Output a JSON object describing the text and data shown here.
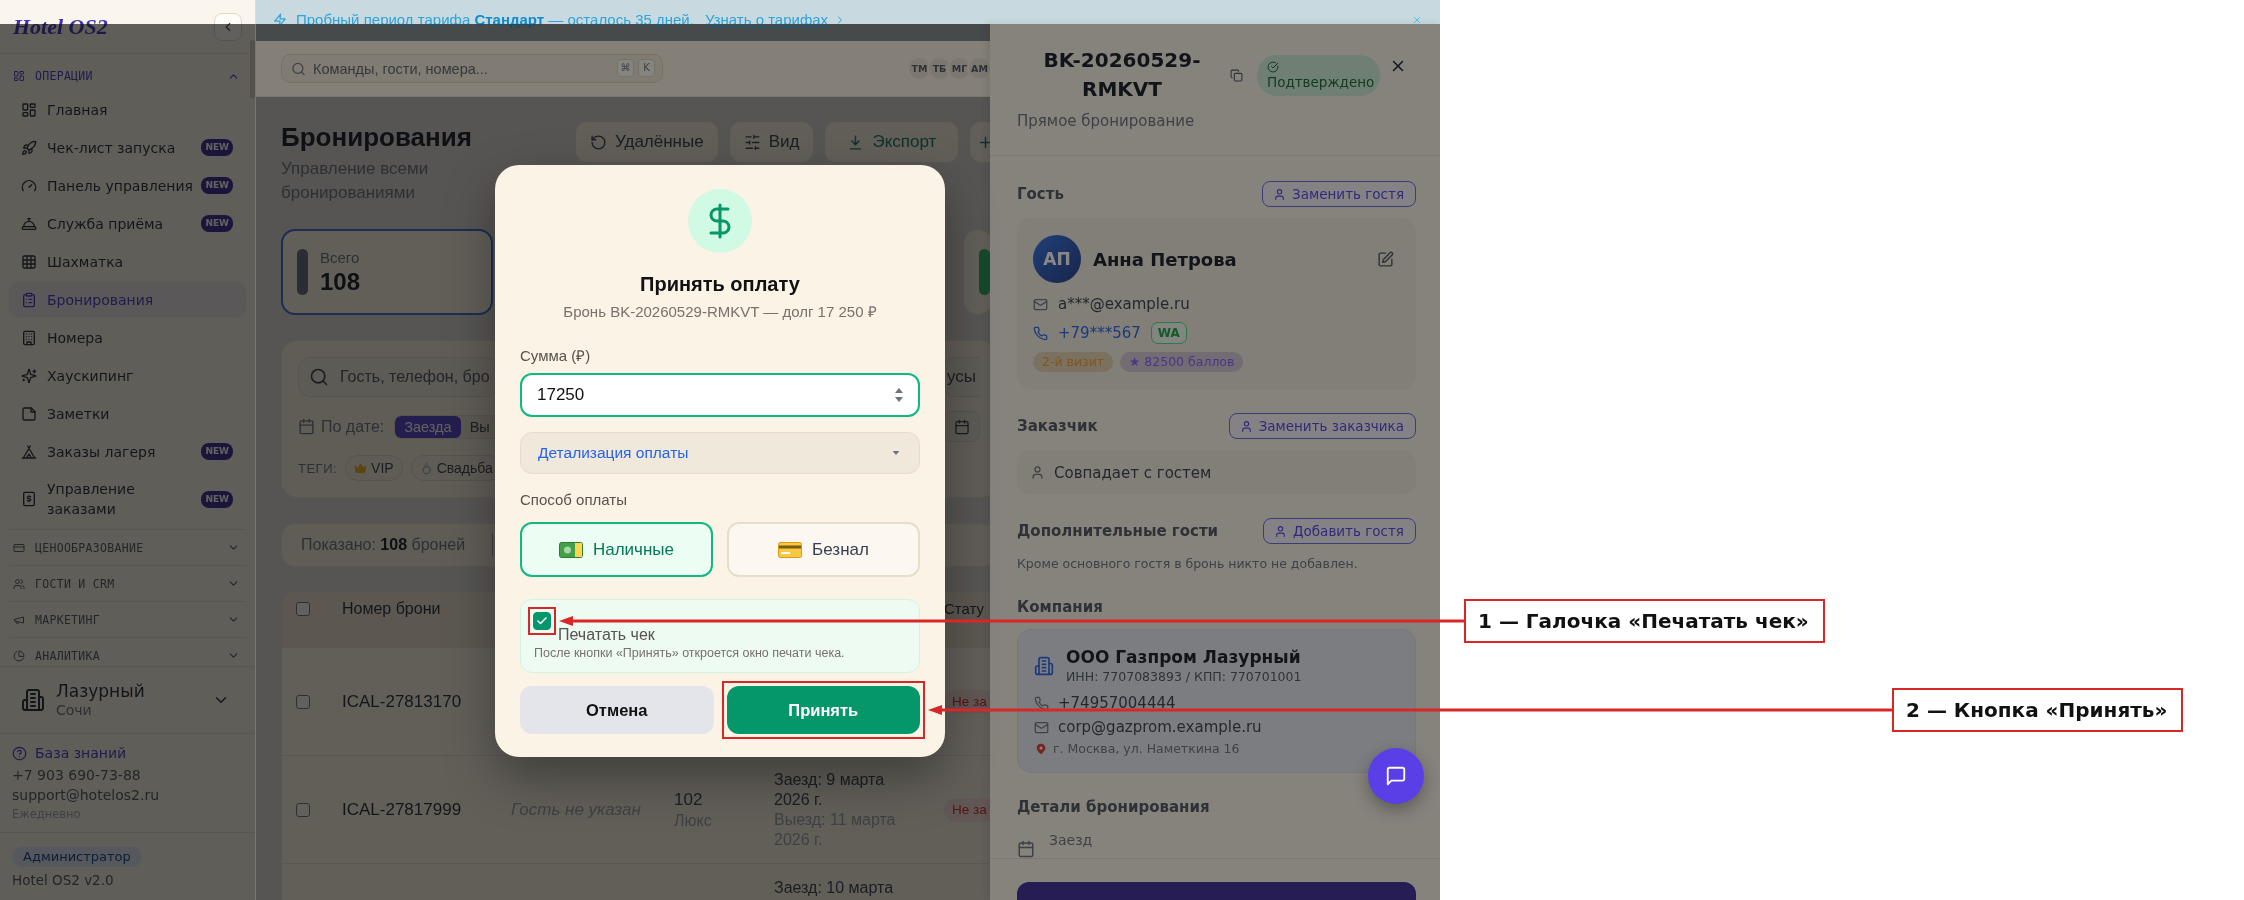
{
  "banner": {
    "message": "Пробный период тарифа **Стандарт** — осталось 35 дней.",
    "link": "Узнать о тарифах"
  },
  "sidebar": {
    "logo": "Hotel OS2",
    "sections": [
      {
        "title": "ОПЕРАЦИИ",
        "expanded": true,
        "items": [
          {
            "label": "Главная",
            "selected": false
          },
          {
            "label": "Чек-лист запуска",
            "badge": "NEW",
            "selected": false
          },
          {
            "label": "Панель управления",
            "badge": "NEW",
            "selected": false
          },
          {
            "label": "Служба приёма",
            "badge": "NEW",
            "selected": false
          },
          {
            "label": "Шахматка",
            "selected": false
          },
          {
            "label": "Бронирования",
            "selected": true
          },
          {
            "label": "Номера",
            "selected": false
          },
          {
            "label": "Хаускипинг",
            "selected": false
          },
          {
            "label": "Заметки",
            "selected": false
          },
          {
            "label": "Заказы лагеря",
            "badge": "NEW",
            "selected": false
          },
          {
            "label": "Управление заказами",
            "badge": "NEW",
            "selected": false
          }
        ]
      },
      {
        "title": "ЦЕНООБРАЗОВАНИЕ",
        "expanded": false
      },
      {
        "title": "ГОСТИ И CRM",
        "expanded": false
      },
      {
        "title": "МАРКЕТИНГ",
        "expanded": false
      },
      {
        "title": "АНАЛИТИКА",
        "expanded": false
      }
    ],
    "hotel": {
      "name": "Лазурный",
      "city": "Сочи"
    },
    "support": {
      "link": "База знаний",
      "phone": "+7 903 690-73-88",
      "email": "support@hotelos2.ru",
      "hours": "Ежедневно"
    },
    "role": "Администратор",
    "version": "Hotel OS2 v2.0"
  },
  "header": {
    "search": {
      "placeholder": "Команды, гости, номера...",
      "keys": [
        "⌘",
        "K"
      ]
    },
    "users": [
      "ТМ",
      "ТБ",
      "МГ",
      "АМ"
    ]
  },
  "page": {
    "title": "Бронирования",
    "subtitle": "Управление всеми бронированиями",
    "actions": [
      {
        "label": "Удалённые",
        "kind": "plain"
      },
      {
        "label": "Вид",
        "kind": "plain"
      },
      {
        "label": "Экспорт",
        "kind": "accent"
      },
      {
        "kind": "add"
      }
    ],
    "stats": [
      {
        "label": "Всего",
        "value": "108",
        "color": "#2a2d33",
        "selected": true
      },
      {
        "color": "#15482a",
        "selected": false
      }
    ],
    "filters": {
      "search": {
        "placeholder": "Гость, телефон, бро"
      },
      "status_filter": "усы",
      "date_label": "По дате:",
      "date_modes": [
        {
          "label": "Заезда",
          "selected": true
        },
        {
          "label": "Вы",
          "selected": false
        }
      ],
      "tags_label": "ТЕГИ:",
      "tags": [
        "VIP",
        "Свадьба"
      ]
    },
    "summary": "Показано: **108** броней",
    "table": {
      "header": {
        "checked": false,
        "booking_number": "Номер брони",
        "column_6": "Стату"
      },
      "rows": [
        {
          "checked": false,
          "booking_number": "ICAL-27813170",
          "status": "Не за"
        },
        {
          "checked": false,
          "booking_number": "ICAL-27817999",
          "guest": "Гость не указан",
          "room": "102",
          "room_type": "Люкс",
          "check_in": "Заезд: 9 марта 2026 г.",
          "check_out": "Выезд: 11 марта 2026 г.",
          "status": "Не за"
        },
        {
          "check_in": "Заезд: 10 марта"
        }
      ]
    }
  },
  "booking_panel": {
    "code": "BK-20260529-RMKVT",
    "status": "Подтверждено",
    "source": "Прямое бронирование",
    "guest": {
      "heading": "Гость",
      "action": "Заменить гостя",
      "initials": "АП",
      "name": "Анна Петрова",
      "email": "a***@example.ru",
      "phone": "+79***567",
      "messenger": "WA",
      "tags": [
        {
          "label": "2-й визит",
          "color": "#80551f"
        },
        {
          "label": "★ 82500 баллов",
          "color": "#4c3585"
        }
      ]
    },
    "customer": {
      "heading": "Заказчик",
      "action": "Заменить заказчика",
      "value": "Совпадает с гостем"
    },
    "extra_guests": {
      "heading": "Дополнительные гости",
      "action": "Добавить гостя",
      "empty": "Кроме основного гостя в бронь никто не добавлен."
    },
    "company": {
      "heading": "Компания",
      "name": "ООО Газпром Лазурный",
      "ids": "ИНН: 7707083893 / КПП: 770701001",
      "phone": "+74957004444",
      "email": "corp@gazprom.example.ru",
      "address": "г. Москва, ул. Наметкина 16"
    },
    "details": {
      "heading": "Детали бронирования",
      "check_in_label": "Заезд"
    }
  },
  "payment_dialog": {
    "title": "Принять оплату",
    "subtitle": "Бронь BK-20260529-RMKVT — долг 17 250 ₽",
    "amount_label": "Сумма (₽)",
    "amount": "17250",
    "details": {
      "label": "Детализация оплаты",
      "expanded": false
    },
    "method_label": "Способ оплаты",
    "methods": [
      {
        "label": "Наличные",
        "selected": true
      },
      {
        "label": "Безнал",
        "selected": false
      }
    ],
    "receipt": {
      "label": "Печатать чек",
      "checked": true,
      "hint": "После кнопки «Принять» откроется окно печати чека."
    },
    "buttons": [
      {
        "label": "Отмена",
        "kind": "secondary"
      },
      {
        "label": "Принять",
        "kind": "primary"
      }
    ]
  },
  "annotations": [
    {
      "text": "1 — Галочка «Печатать чек»"
    },
    {
      "text": "2 — Кнопка «Принять»"
    }
  ]
}
